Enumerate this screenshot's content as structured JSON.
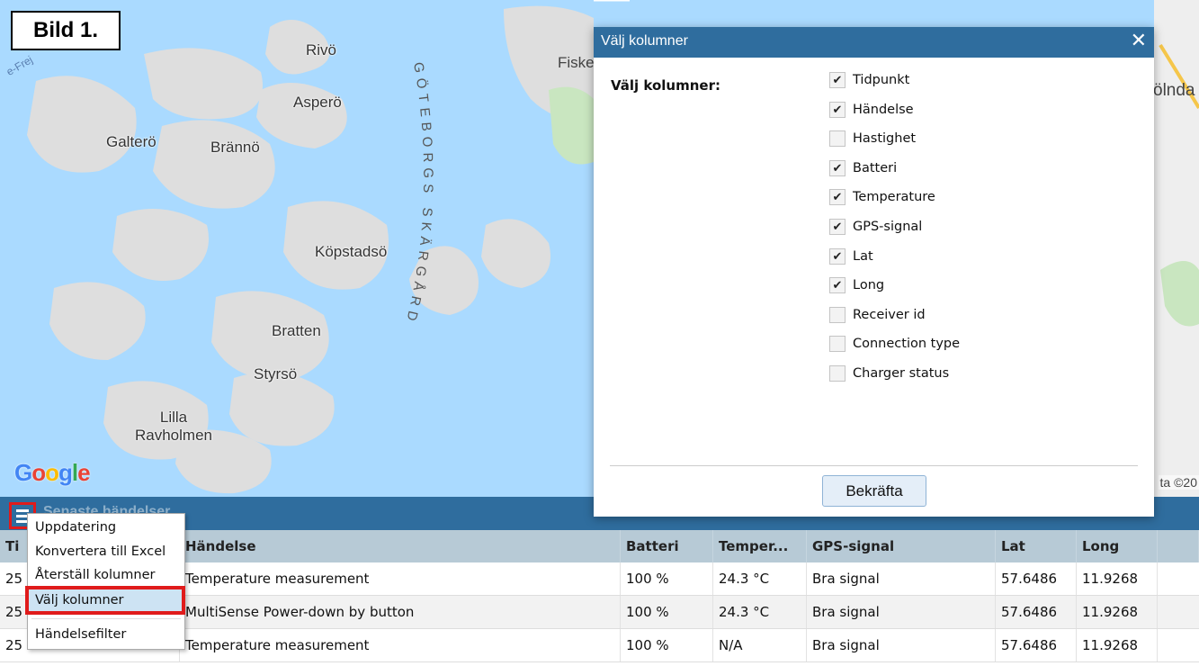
{
  "figure_label": "Bild 1.",
  "map": {
    "places": [
      "Rivö",
      "Asperö",
      "Galterö",
      "Brännö",
      "Köpstadsö",
      "Bratten",
      "Styrsö",
      "Lilla Ravholmen"
    ],
    "archipelago_label": "GÖTEBORGS SKÄRGÅRD",
    "edge_labels": {
      "fiske": "Fiske",
      "olnda": "ölnda",
      "freja": "e-Frej"
    },
    "google_logo": "Google",
    "attribution": "ta ©20"
  },
  "panel": {
    "title": "Senaste händelser",
    "menu_icon": "hamburger-menu-icon"
  },
  "context_menu": {
    "items": [
      "Uppdatering",
      "Konvertera till Excel",
      "Återställ kolumner",
      "Välj kolumner",
      "Händelsefilter"
    ],
    "selected": "Välj kolumner"
  },
  "table": {
    "headers": [
      "Ti",
      "Händelse",
      "Batteri",
      "Temper...",
      "GPS-signal",
      "Lat",
      "Long",
      ""
    ],
    "rows": [
      [
        "25",
        "Temperature measurement",
        "100 %",
        "24.3 °C",
        "Bra signal",
        "57.6486",
        "11.9268",
        ""
      ],
      [
        "25",
        "MultiSense Power-down by button",
        "100 %",
        "24.3 °C",
        "Bra signal",
        "57.6486",
        "11.9268",
        ""
      ],
      [
        "25",
        "Temperature measurement",
        "100 %",
        "N/A",
        "Bra signal",
        "57.6486",
        "11.9268",
        ""
      ]
    ]
  },
  "dialog": {
    "title": "Välj kolumner",
    "close_icon": "close-icon",
    "label": "Välj kolumner:",
    "columns": [
      {
        "label": "Tidpunkt",
        "checked": true
      },
      {
        "label": "Händelse",
        "checked": true
      },
      {
        "label": "Hastighet",
        "checked": false
      },
      {
        "label": "Batteri",
        "checked": true
      },
      {
        "label": "Temperature",
        "checked": true
      },
      {
        "label": "GPS-signal",
        "checked": true
      },
      {
        "label": "Lat",
        "checked": true
      },
      {
        "label": "Long",
        "checked": true
      },
      {
        "label": "Receiver id",
        "checked": false
      },
      {
        "label": "Connection type",
        "checked": false
      },
      {
        "label": "Charger status",
        "checked": false
      }
    ],
    "confirm_label": "Bekräfta"
  },
  "colors": {
    "header_blue": "#2f6d9e",
    "water": "#aadaff",
    "land": "#dcdcdc",
    "highlight_red": "#e01b1b"
  }
}
